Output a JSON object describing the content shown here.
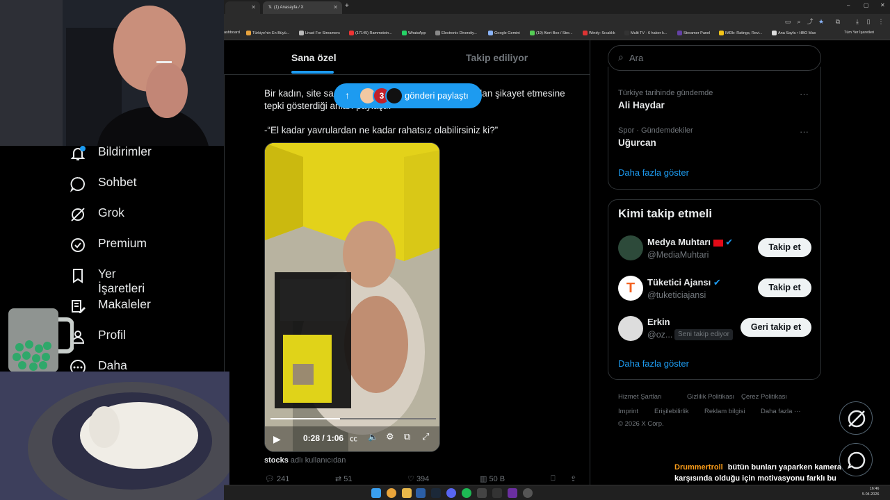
{
  "browser": {
    "tab_title": "(1) Anasayfa / X",
    "bookmarks": [
      "ashboard",
      "Türkiye'nin En Büyü...",
      "Livad For Streamers",
      "(17145) Rammstein...",
      "WhatsApp",
      "Electronic Diversity...",
      "Google Gemini",
      "(19) Alert Box / Stre...",
      "Windy: Sıcaklık",
      "Multi TV - 6 haber k...",
      "Streamer Panel",
      "IMDb: Ratings, Revi...",
      "Ana Sayfa • HBO Max",
      "Tüm Yer İşaretleri"
    ]
  },
  "feed_tabs": {
    "for_you": "Sana özel",
    "following": "Takip ediliyor"
  },
  "toast": {
    "label": "gönderi paylaştı",
    "badge": "3"
  },
  "tweet": {
    "line1_start": "Bir kadın, site sa",
    "line1_end": "dan şikayet etmesine",
    "line2": "tepki gösterdiği anları paylaştı.",
    "quote": "-“El kadar yavrulardan ne kadar rahatsız olabilirsiniz ki?”",
    "video_time": "0:28 / 1:06",
    "source_handle": "stocks",
    "source_suffix": "adlı kullanıcıdan",
    "replies": "241",
    "reposts": "51",
    "likes": "394",
    "views": "50 B"
  },
  "nav": [
    "Bildirimler",
    "Sohbet",
    "Grok",
    "Premium",
    "Yer İşaretleri",
    "Makaleler",
    "Profil",
    "Daha fazla"
  ],
  "search": {
    "placeholder": "Ara"
  },
  "trends": [
    {
      "category": "Türkiye tarihinde gündemde",
      "name": "Ali Haydar"
    },
    {
      "category": "Spor · Gündemdekiler",
      "name": "Uğurcan"
    }
  ],
  "show_more": "Daha fazla göster",
  "who_to_follow": {
    "title": "Kimi takip etmeli",
    "users": [
      {
        "name": "Medya Muhtarı",
        "handle": "@MediaMuhtari",
        "button": "Takip et"
      },
      {
        "name": "Tüketici Ajansı",
        "handle": "@tuketiciajansi",
        "button": "Takip et",
        "avatar_letter": "T"
      },
      {
        "name": "Erkin",
        "handle": "@oz...",
        "badge": "Seni takip ediyor",
        "button": "Geri takip et"
      }
    ]
  },
  "footer": [
    "Hizmet Şartları",
    "Gizlilik Politikası",
    "Çerez Politikası",
    "Imprint",
    "Erişilebilirlik",
    "Reklam bilgisi",
    "Daha fazla ···",
    "© 2026 X Corp."
  ],
  "chat": {
    "user": "Drummertroll",
    "message": "bütün bunları yaparken kamera karşısında olduğu için motivasyonu farklı bu hanımefendinin, bilmem anlatabildim mi."
  },
  "clock": {
    "time": "16:46",
    "date": "5.04.2026"
  },
  "colors": {
    "accent": "#1d9bf0",
    "chat_user": "#ff9f1a"
  }
}
